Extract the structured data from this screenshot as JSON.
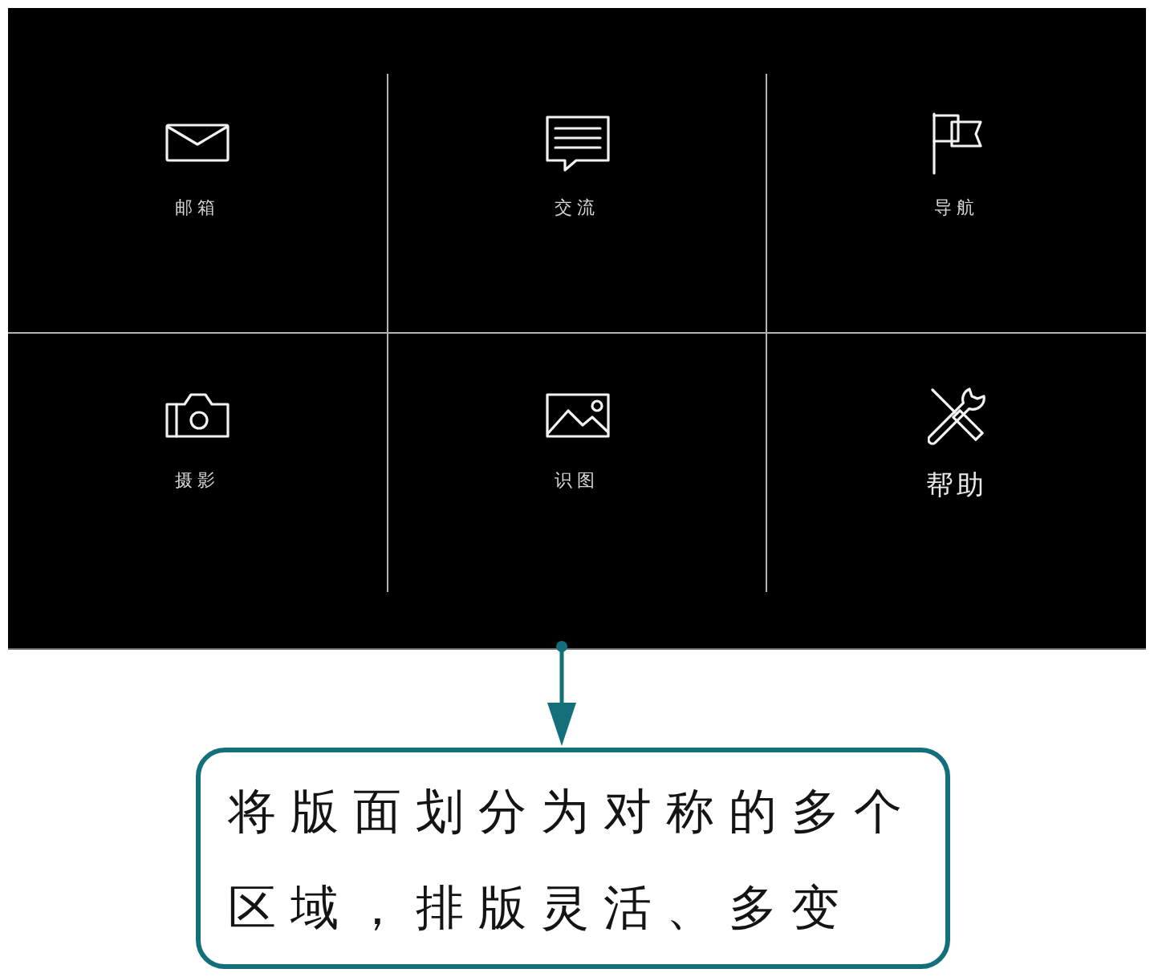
{
  "panel": {
    "rows": [
      {
        "tiles": [
          {
            "kind": "mail",
            "label": "邮箱",
            "large_label": false
          },
          {
            "kind": "chat",
            "label": "交流",
            "large_label": false
          },
          {
            "kind": "flag",
            "label": "导航",
            "large_label": false
          }
        ]
      },
      {
        "tiles": [
          {
            "kind": "camera",
            "label": "摄影",
            "large_label": false
          },
          {
            "kind": "image",
            "label": "识图",
            "large_label": false
          },
          {
            "kind": "tools",
            "label": "帮助",
            "large_label": true
          }
        ]
      }
    ]
  },
  "callout": {
    "text": "将版面划分为对称的多个区域，排版灵活、多变"
  }
}
